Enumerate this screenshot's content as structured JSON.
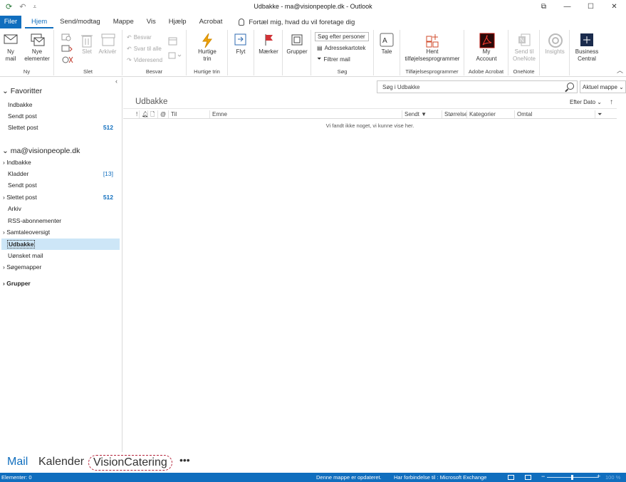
{
  "window": {
    "title": "Udbakke - ma@visionpeople.dk - Outlook",
    "quick_access": {
      "refresh_icon": "send-receive-icon",
      "undo_icon": "undo-icon",
      "more": "⩡"
    },
    "controls": [
      "⧉",
      "—",
      "☐",
      "✕"
    ]
  },
  "tabs": {
    "file": "Filer",
    "items": [
      "Hjem",
      "Send/modtag",
      "Mappe",
      "Vis",
      "Hjælp",
      "Acrobat"
    ],
    "tell_me": "Fortæl mig, hvad du vil foretage dig"
  },
  "ribbon": {
    "ny": {
      "label": "Ny",
      "new_mail": "Ny\nmail",
      "new_items": "Nye\nelementer"
    },
    "slet": {
      "label": "Slet",
      "delete": "Slet",
      "archive": "Arkivér"
    },
    "besvar": {
      "label": "Besvar",
      "reply": "Besvar",
      "reply_all": "Svar til alle",
      "forward": "Videresend"
    },
    "hurtige": {
      "label": "Hurtige trin",
      "quick_steps": "Hurtige\ntrin"
    },
    "flyt": {
      "label": "Flyt"
    },
    "maerker": {
      "label": "Mærker"
    },
    "grupper": {
      "label": "Grupper"
    },
    "soeg": {
      "label": "Søg",
      "search_people": "Søg efter personer",
      "address_book": "Adressekartotek",
      "filter_mail": "Filtrer mail"
    },
    "tale": {
      "label": "Tale"
    },
    "addins": {
      "label": "Tilføjelsesprogrammer",
      "get": "Hent\ntilføjelsesprogrammer"
    },
    "acrobat": {
      "label": "Adobe Acrobat",
      "my_account": "My\nAccount"
    },
    "onenote": {
      "label": "OneNote",
      "send": "Send til\nOneNote"
    },
    "insights": {
      "label": "Insights"
    },
    "bc": {
      "label": "Business\nCentral"
    }
  },
  "nav": {
    "favorites_header": "Favoritter",
    "favorites": [
      {
        "label": "Indbakke"
      },
      {
        "label": "Sendt post"
      },
      {
        "label": "Slettet post",
        "count": "512"
      }
    ],
    "account": "ma@visionpeople.dk",
    "folders": [
      {
        "label": "Indbakke",
        "expand": true
      },
      {
        "label": "Kladder",
        "count": "[13]"
      },
      {
        "label": "Sendt post"
      },
      {
        "label": "Slettet post",
        "expand": true,
        "count": "512"
      },
      {
        "label": "Arkiv"
      },
      {
        "label": "RSS-abonnementer"
      },
      {
        "label": "Samtaleoversigt",
        "expand": true
      },
      {
        "label": "Udbakke",
        "selected": true
      },
      {
        "label": "Uønsket mail"
      },
      {
        "label": "Søgemapper",
        "expand": true
      }
    ],
    "groups": "Grupper"
  },
  "main": {
    "search_placeholder": "Søg i Udbakke",
    "scope": "Aktuel mappe",
    "folder_title": "Udbakke",
    "sort_by": "Efter Dato",
    "columns": {
      "to": "Til",
      "subject": "Emne",
      "sent": "Sendt",
      "size": "Størrelse",
      "categories": "Kategorier",
      "mention": "Omtal"
    },
    "empty_message": "Vi fandt ikke noget, vi kunne vise her."
  },
  "bottom_nav": {
    "mail": "Mail",
    "calendar": "Kalender",
    "vc": "VisionCatering",
    "more": "•••"
  },
  "status": {
    "items": "Elementer: 0",
    "updated": "Denne mappe er opdateret.",
    "connection": "Har forbindelse til : Microsoft Exchange",
    "zoom": "100 %"
  },
  "colors": {
    "accent": "#106ebe",
    "selected": "#cde6f7",
    "count": "#106ebe",
    "vc_border": "#b4233a"
  }
}
